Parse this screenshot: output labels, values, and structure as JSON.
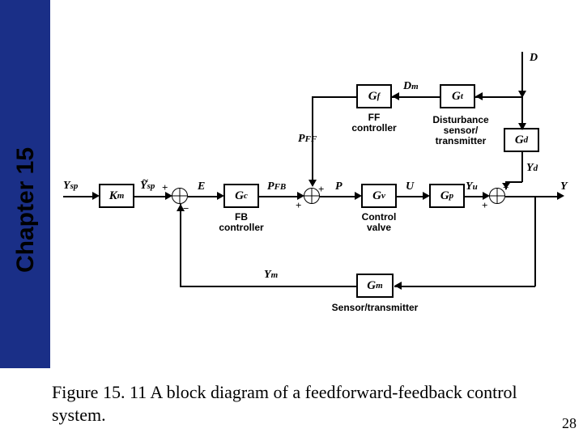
{
  "chapter_label": "Chapter 15",
  "caption": "Figure 15. 11 A block diagram of a feedforward-feedback control system.",
  "page_number": "28",
  "blocks": {
    "Km": {
      "sym": "K",
      "sub": "m"
    },
    "Gc": {
      "sym": "G",
      "sub": "c"
    },
    "Gv": {
      "sym": "G",
      "sub": "v"
    },
    "Gp": {
      "sym": "G",
      "sub": "p"
    },
    "Gm": {
      "sym": "G",
      "sub": "m"
    },
    "Gf": {
      "sym": "G",
      "sub": "f"
    },
    "Gt": {
      "sym": "G",
      "sub": "t"
    },
    "Gd": {
      "sym": "G",
      "sub": "d"
    }
  },
  "labels": {
    "ff": "FF controller",
    "fb": "FB controller",
    "cv": "Control valve",
    "st": "Sensor/transmitter",
    "dst": "Disturbance sensor/ transmitter"
  },
  "signals": {
    "Ysp": {
      "sym": "Y",
      "sub": "sp"
    },
    "Yspt": {
      "sym": "Y",
      "sub": "sp",
      "tilde": true
    },
    "E": {
      "sym": "E",
      "sub": ""
    },
    "PFB": {
      "sym": "P",
      "sub": "FB"
    },
    "PFF": {
      "sym": "P",
      "sub": "FF"
    },
    "P": {
      "sym": "P",
      "sub": ""
    },
    "U": {
      "sym": "U",
      "sub": ""
    },
    "Yu": {
      "sym": "Y",
      "sub": "u"
    },
    "Yd": {
      "sym": "Y",
      "sub": "d"
    },
    "Y": {
      "sym": "Y",
      "sub": ""
    },
    "Ym": {
      "sym": "Y",
      "sub": "m"
    },
    "D": {
      "sym": "D",
      "sub": ""
    },
    "Dm": {
      "sym": "D",
      "sub": "m"
    }
  },
  "signs": {
    "plus": "+",
    "minus": "−"
  }
}
